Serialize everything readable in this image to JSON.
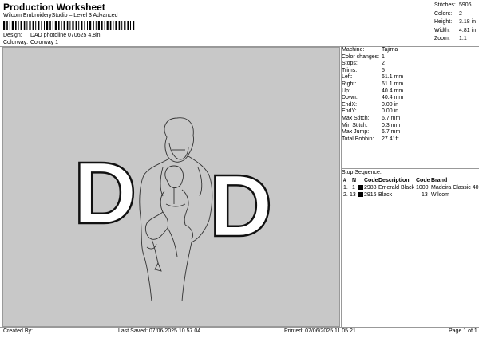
{
  "header": {
    "title": "Production Worksheet",
    "subtitle": "Wilcom EmbroideryStudio – Level 3 Advanced"
  },
  "design_info": {
    "design_label": "Design:",
    "design_value": "DAD photoline 070625 4,8in",
    "colorway_label": "Colorway:",
    "colorway_value": "Colorway 1"
  },
  "stats": [
    {
      "label": "Stitches:",
      "value": "5906"
    },
    {
      "label": "Colors:",
      "value": "2"
    },
    {
      "label": "Height:",
      "value": "3.18 in"
    },
    {
      "label": "Width:",
      "value": "4.81 in"
    },
    {
      "label": "Zoom:",
      "value": "1:1"
    }
  ],
  "machine": [
    {
      "label": "Machine:",
      "value": "Tajima"
    },
    {
      "label": "Color changes:",
      "value": "1"
    },
    {
      "label": "Stops:",
      "value": "2"
    },
    {
      "label": "Trims:",
      "value": "5"
    },
    {
      "label": "Left:",
      "value": "61.1 mm"
    },
    {
      "label": "Right:",
      "value": "61.1 mm"
    },
    {
      "label": "Up:",
      "value": "40.4 mm"
    },
    {
      "label": "Down:",
      "value": "40.4 mm"
    },
    {
      "label": "EndX:",
      "value": "0.00 in"
    },
    {
      "label": "EndY:",
      "value": "0.00 in"
    },
    {
      "label": "Max Stitch:",
      "value": "6.7 mm"
    },
    {
      "label": "Min Stitch:",
      "value": "0.3 mm"
    },
    {
      "label": "Max Jump:",
      "value": "6.7 mm"
    },
    {
      "label": "Total Bobbin:",
      "value": "27.41ft"
    }
  ],
  "stop_sequence": {
    "title": "Stop Sequence:",
    "headers": [
      "#",
      "N",
      "Code",
      "Description",
      "Code",
      "Brand"
    ],
    "rows": [
      {
        "num": "1.",
        "n": "1",
        "code": "2988",
        "desc": "Emerald Black",
        "code2": "1000",
        "brand": "Madeira Classic 40",
        "color": "#000000"
      },
      {
        "num": "2.",
        "n": "13",
        "code": "2916",
        "desc": "Black",
        "code2": "13",
        "brand": "Wilcom",
        "color": "#000000"
      }
    ]
  },
  "footer": {
    "created_by": "Created By:",
    "last_saved": "Last Saved: 07/06/2025 10.57.04",
    "printed": "Printed: 07/06/2025 11.05.21",
    "page": "Page 1 of 1"
  },
  "design_letters": {
    "left": "D",
    "right": "D"
  }
}
